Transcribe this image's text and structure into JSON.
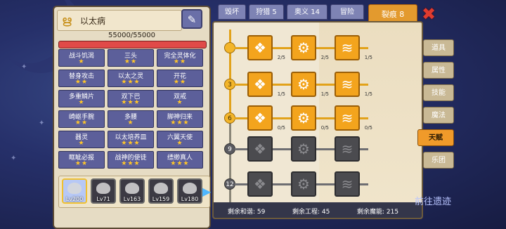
{
  "left_panel": {
    "title": "以太病",
    "hp_text": "55000/55000",
    "skills": [
      {
        "name": "战斗饥渴",
        "stars": "★"
      },
      {
        "name": "三头",
        "stars": "★★"
      },
      {
        "name": "完全灵体化",
        "stars": "★★"
      },
      {
        "name": "替身攻击",
        "stars": "★★"
      },
      {
        "name": "以太之灵",
        "stars": "★★★"
      },
      {
        "name": "开花",
        "stars": "★★"
      },
      {
        "name": "多重鳞片",
        "stars": "★"
      },
      {
        "name": "双下巴",
        "stars": "★★★"
      },
      {
        "name": "双戒",
        "stars": "★"
      },
      {
        "name": "崎岖手腕",
        "stars": "★★"
      },
      {
        "name": "多腰",
        "stars": "★"
      },
      {
        "name": "脚神归来",
        "stars": "★★★"
      },
      {
        "name": "器灵",
        "stars": "★"
      },
      {
        "name": "以太培养皿",
        "stars": "★★★"
      },
      {
        "name": "六翼天使",
        "stars": "★"
      },
      {
        "name": "眶眦必报",
        "stars": "★★"
      },
      {
        "name": "战神的使徒",
        "stars": "★★★"
      },
      {
        "name": "缥缈真人",
        "stars": "★★★"
      }
    ],
    "heroes": [
      {
        "level": "Lv200",
        "selected": true
      },
      {
        "level": "Lv71",
        "selected": false
      },
      {
        "level": "Lv163",
        "selected": false
      },
      {
        "level": "Lv159",
        "selected": false
      },
      {
        "level": "Lv180",
        "selected": false
      }
    ]
  },
  "top_tabs": [
    {
      "label": "毁坏"
    },
    {
      "label": "狩猎 5"
    },
    {
      "label": "奥义 14"
    },
    {
      "label": "冒险"
    },
    {
      "label": "裂痕 8",
      "active": true
    }
  ],
  "talent_tree": {
    "levels": [
      "",
      "3",
      "6",
      "9",
      "12"
    ],
    "rows": [
      [
        {
          "icon": "❖",
          "count": "2/5",
          "on": true
        },
        {
          "icon": "⚙",
          "count": "2/5",
          "on": true
        },
        {
          "icon": "≋",
          "count": "1/5",
          "on": true
        }
      ],
      [
        {
          "icon": "❖",
          "count": "1/5",
          "on": true
        },
        {
          "icon": "⚙",
          "count": "1/5",
          "on": true
        },
        {
          "icon": "≋",
          "count": "1/5",
          "on": true
        }
      ],
      [
        {
          "icon": "❖",
          "count": "0/5",
          "on": true
        },
        {
          "icon": "⚙",
          "count": "0/5",
          "on": true
        },
        {
          "icon": "≋",
          "count": "0/5",
          "on": true
        }
      ],
      [
        {
          "icon": "❖",
          "count": "",
          "on": false
        },
        {
          "icon": "⚙",
          "count": "",
          "on": false
        },
        {
          "icon": "≋",
          "count": "",
          "on": false
        }
      ],
      [
        {
          "icon": "❖",
          "count": "",
          "on": false
        },
        {
          "icon": "⚙",
          "count": "",
          "on": false
        },
        {
          "icon": "≋",
          "count": "",
          "on": false
        }
      ]
    ],
    "footer": {
      "harmony": "剩余和谐: 59",
      "engineering": "剩余工程: 45",
      "magic": "剩余魔能: 215"
    }
  },
  "side_menu": [
    {
      "label": "道具"
    },
    {
      "label": "属性"
    },
    {
      "label": "技能"
    },
    {
      "label": "魔法"
    },
    {
      "label": "天赋",
      "active": true
    },
    {
      "label": "乐团"
    }
  ],
  "goto_label": "前往遗迹",
  "icons": {
    "close": "close-icon",
    "edit": "pencil-icon",
    "rune": "rune-icon",
    "arrow": "arrow-right-icon"
  },
  "colors": {
    "accent_orange": "#f3a41d",
    "tab_blue": "#7e83b4",
    "hp_red": "#e04a48",
    "star_gold": "#ffc629"
  }
}
